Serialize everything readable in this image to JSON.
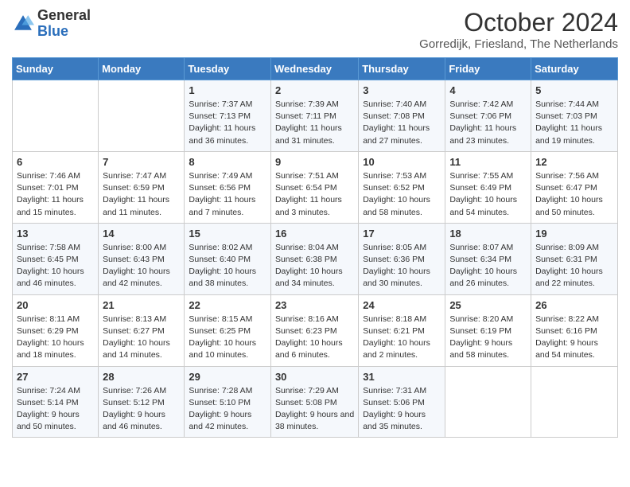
{
  "header": {
    "logo_general": "General",
    "logo_blue": "Blue",
    "month_title": "October 2024",
    "location": "Gorredijk, Friesland, The Netherlands"
  },
  "days_of_week": [
    "Sunday",
    "Monday",
    "Tuesday",
    "Wednesday",
    "Thursday",
    "Friday",
    "Saturday"
  ],
  "weeks": [
    [
      {
        "day": "",
        "content": ""
      },
      {
        "day": "",
        "content": ""
      },
      {
        "day": "1",
        "content": "Sunrise: 7:37 AM\nSunset: 7:13 PM\nDaylight: 11 hours and 36 minutes."
      },
      {
        "day": "2",
        "content": "Sunrise: 7:39 AM\nSunset: 7:11 PM\nDaylight: 11 hours and 31 minutes."
      },
      {
        "day": "3",
        "content": "Sunrise: 7:40 AM\nSunset: 7:08 PM\nDaylight: 11 hours and 27 minutes."
      },
      {
        "day": "4",
        "content": "Sunrise: 7:42 AM\nSunset: 7:06 PM\nDaylight: 11 hours and 23 minutes."
      },
      {
        "day": "5",
        "content": "Sunrise: 7:44 AM\nSunset: 7:03 PM\nDaylight: 11 hours and 19 minutes."
      }
    ],
    [
      {
        "day": "6",
        "content": "Sunrise: 7:46 AM\nSunset: 7:01 PM\nDaylight: 11 hours and 15 minutes."
      },
      {
        "day": "7",
        "content": "Sunrise: 7:47 AM\nSunset: 6:59 PM\nDaylight: 11 hours and 11 minutes."
      },
      {
        "day": "8",
        "content": "Sunrise: 7:49 AM\nSunset: 6:56 PM\nDaylight: 11 hours and 7 minutes."
      },
      {
        "day": "9",
        "content": "Sunrise: 7:51 AM\nSunset: 6:54 PM\nDaylight: 11 hours and 3 minutes."
      },
      {
        "day": "10",
        "content": "Sunrise: 7:53 AM\nSunset: 6:52 PM\nDaylight: 10 hours and 58 minutes."
      },
      {
        "day": "11",
        "content": "Sunrise: 7:55 AM\nSunset: 6:49 PM\nDaylight: 10 hours and 54 minutes."
      },
      {
        "day": "12",
        "content": "Sunrise: 7:56 AM\nSunset: 6:47 PM\nDaylight: 10 hours and 50 minutes."
      }
    ],
    [
      {
        "day": "13",
        "content": "Sunrise: 7:58 AM\nSunset: 6:45 PM\nDaylight: 10 hours and 46 minutes."
      },
      {
        "day": "14",
        "content": "Sunrise: 8:00 AM\nSunset: 6:43 PM\nDaylight: 10 hours and 42 minutes."
      },
      {
        "day": "15",
        "content": "Sunrise: 8:02 AM\nSunset: 6:40 PM\nDaylight: 10 hours and 38 minutes."
      },
      {
        "day": "16",
        "content": "Sunrise: 8:04 AM\nSunset: 6:38 PM\nDaylight: 10 hours and 34 minutes."
      },
      {
        "day": "17",
        "content": "Sunrise: 8:05 AM\nSunset: 6:36 PM\nDaylight: 10 hours and 30 minutes."
      },
      {
        "day": "18",
        "content": "Sunrise: 8:07 AM\nSunset: 6:34 PM\nDaylight: 10 hours and 26 minutes."
      },
      {
        "day": "19",
        "content": "Sunrise: 8:09 AM\nSunset: 6:31 PM\nDaylight: 10 hours and 22 minutes."
      }
    ],
    [
      {
        "day": "20",
        "content": "Sunrise: 8:11 AM\nSunset: 6:29 PM\nDaylight: 10 hours and 18 minutes."
      },
      {
        "day": "21",
        "content": "Sunrise: 8:13 AM\nSunset: 6:27 PM\nDaylight: 10 hours and 14 minutes."
      },
      {
        "day": "22",
        "content": "Sunrise: 8:15 AM\nSunset: 6:25 PM\nDaylight: 10 hours and 10 minutes."
      },
      {
        "day": "23",
        "content": "Sunrise: 8:16 AM\nSunset: 6:23 PM\nDaylight: 10 hours and 6 minutes."
      },
      {
        "day": "24",
        "content": "Sunrise: 8:18 AM\nSunset: 6:21 PM\nDaylight: 10 hours and 2 minutes."
      },
      {
        "day": "25",
        "content": "Sunrise: 8:20 AM\nSunset: 6:19 PM\nDaylight: 9 hours and 58 minutes."
      },
      {
        "day": "26",
        "content": "Sunrise: 8:22 AM\nSunset: 6:16 PM\nDaylight: 9 hours and 54 minutes."
      }
    ],
    [
      {
        "day": "27",
        "content": "Sunrise: 7:24 AM\nSunset: 5:14 PM\nDaylight: 9 hours and 50 minutes."
      },
      {
        "day": "28",
        "content": "Sunrise: 7:26 AM\nSunset: 5:12 PM\nDaylight: 9 hours and 46 minutes."
      },
      {
        "day": "29",
        "content": "Sunrise: 7:28 AM\nSunset: 5:10 PM\nDaylight: 9 hours and 42 minutes."
      },
      {
        "day": "30",
        "content": "Sunrise: 7:29 AM\nSunset: 5:08 PM\nDaylight: 9 hours and 38 minutes."
      },
      {
        "day": "31",
        "content": "Sunrise: 7:31 AM\nSunset: 5:06 PM\nDaylight: 9 hours and 35 minutes."
      },
      {
        "day": "",
        "content": ""
      },
      {
        "day": "",
        "content": ""
      }
    ]
  ]
}
